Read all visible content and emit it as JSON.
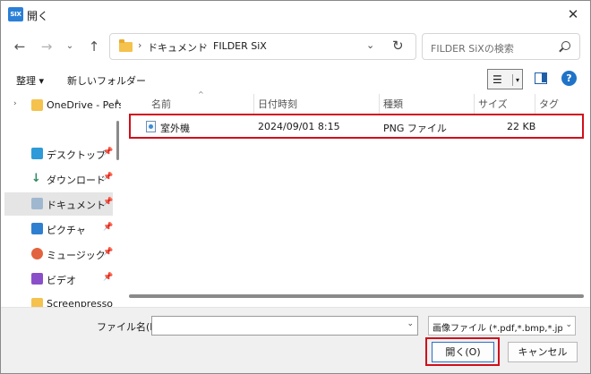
{
  "window": {
    "app_logo": "SIX",
    "title": "開く"
  },
  "nav": {
    "breadcrumbs": [
      "ドキュメント",
      "FILDER SiX"
    ],
    "search_placeholder": "FILDER SiXの検索"
  },
  "toolbar": {
    "organize": "整理 ▾",
    "new_folder": "新しいフォルダー"
  },
  "sidebar": {
    "items": [
      {
        "label": "OneDrive - Perso",
        "icon": "folder-icon"
      },
      {
        "label": "デスクトップ",
        "icon": "desktop-icon"
      },
      {
        "label": "ダウンロード",
        "icon": "download-icon"
      },
      {
        "label": "ドキュメント",
        "icon": "document-icon"
      },
      {
        "label": "ピクチャ",
        "icon": "picture-icon"
      },
      {
        "label": "ミュージック",
        "icon": "music-icon"
      },
      {
        "label": "ビデオ",
        "icon": "video-icon"
      },
      {
        "label": "Screenpresso",
        "icon": "folder-icon"
      }
    ]
  },
  "filelist": {
    "columns": [
      "名前",
      "日付時刻",
      "種類",
      "サイズ",
      "タグ"
    ],
    "rows": [
      {
        "name": "室外機",
        "date": "2024/09/01 8:15",
        "type": "PNG ファイル",
        "size": "22 KB"
      }
    ]
  },
  "footer": {
    "filename_label": "ファイル名(N):",
    "filename_value": "",
    "filetype_value": "画像ファイル (*.pdf,*.bmp,*.jpg,*.jpeg,*.png)",
    "open_button": "開く(O)",
    "cancel_button": "キャンセル"
  },
  "colors": {
    "highlight_border": "#d0101a",
    "accent": "#1f73c8"
  }
}
